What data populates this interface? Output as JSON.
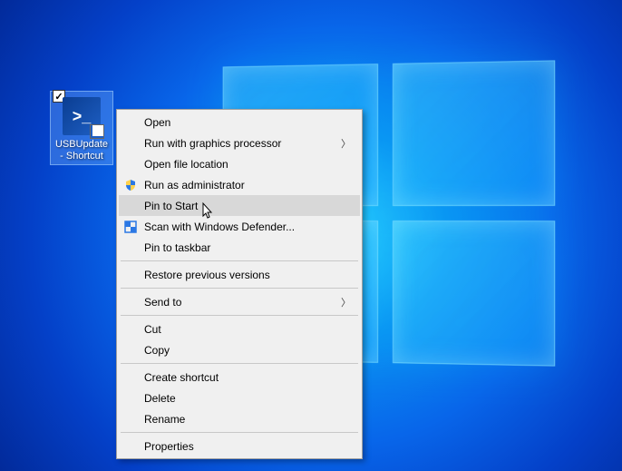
{
  "desktop": {
    "icon": {
      "label": "USBUpdate - Shortcut",
      "checked": true
    }
  },
  "context_menu": {
    "groups": [
      [
        {
          "id": "open",
          "label": "Open",
          "icon": null,
          "submenu": false
        },
        {
          "id": "run-graphics",
          "label": "Run with graphics processor",
          "icon": null,
          "submenu": true
        },
        {
          "id": "open-location",
          "label": "Open file location",
          "icon": null,
          "submenu": false
        },
        {
          "id": "run-admin",
          "label": "Run as administrator",
          "icon": "shield",
          "submenu": false
        },
        {
          "id": "pin-start",
          "label": "Pin to Start",
          "icon": null,
          "submenu": false,
          "hovered": true
        },
        {
          "id": "scan-defender",
          "label": "Scan with Windows Defender...",
          "icon": "defender",
          "submenu": false
        },
        {
          "id": "pin-taskbar",
          "label": "Pin to taskbar",
          "icon": null,
          "submenu": false
        }
      ],
      [
        {
          "id": "restore",
          "label": "Restore previous versions",
          "icon": null,
          "submenu": false
        }
      ],
      [
        {
          "id": "send-to",
          "label": "Send to",
          "icon": null,
          "submenu": true
        }
      ],
      [
        {
          "id": "cut",
          "label": "Cut",
          "icon": null,
          "submenu": false
        },
        {
          "id": "copy",
          "label": "Copy",
          "icon": null,
          "submenu": false
        }
      ],
      [
        {
          "id": "create-shortcut",
          "label": "Create shortcut",
          "icon": null,
          "submenu": false
        },
        {
          "id": "delete",
          "label": "Delete",
          "icon": null,
          "submenu": false
        },
        {
          "id": "rename",
          "label": "Rename",
          "icon": null,
          "submenu": false
        }
      ],
      [
        {
          "id": "properties",
          "label": "Properties",
          "icon": null,
          "submenu": false
        }
      ]
    ]
  }
}
